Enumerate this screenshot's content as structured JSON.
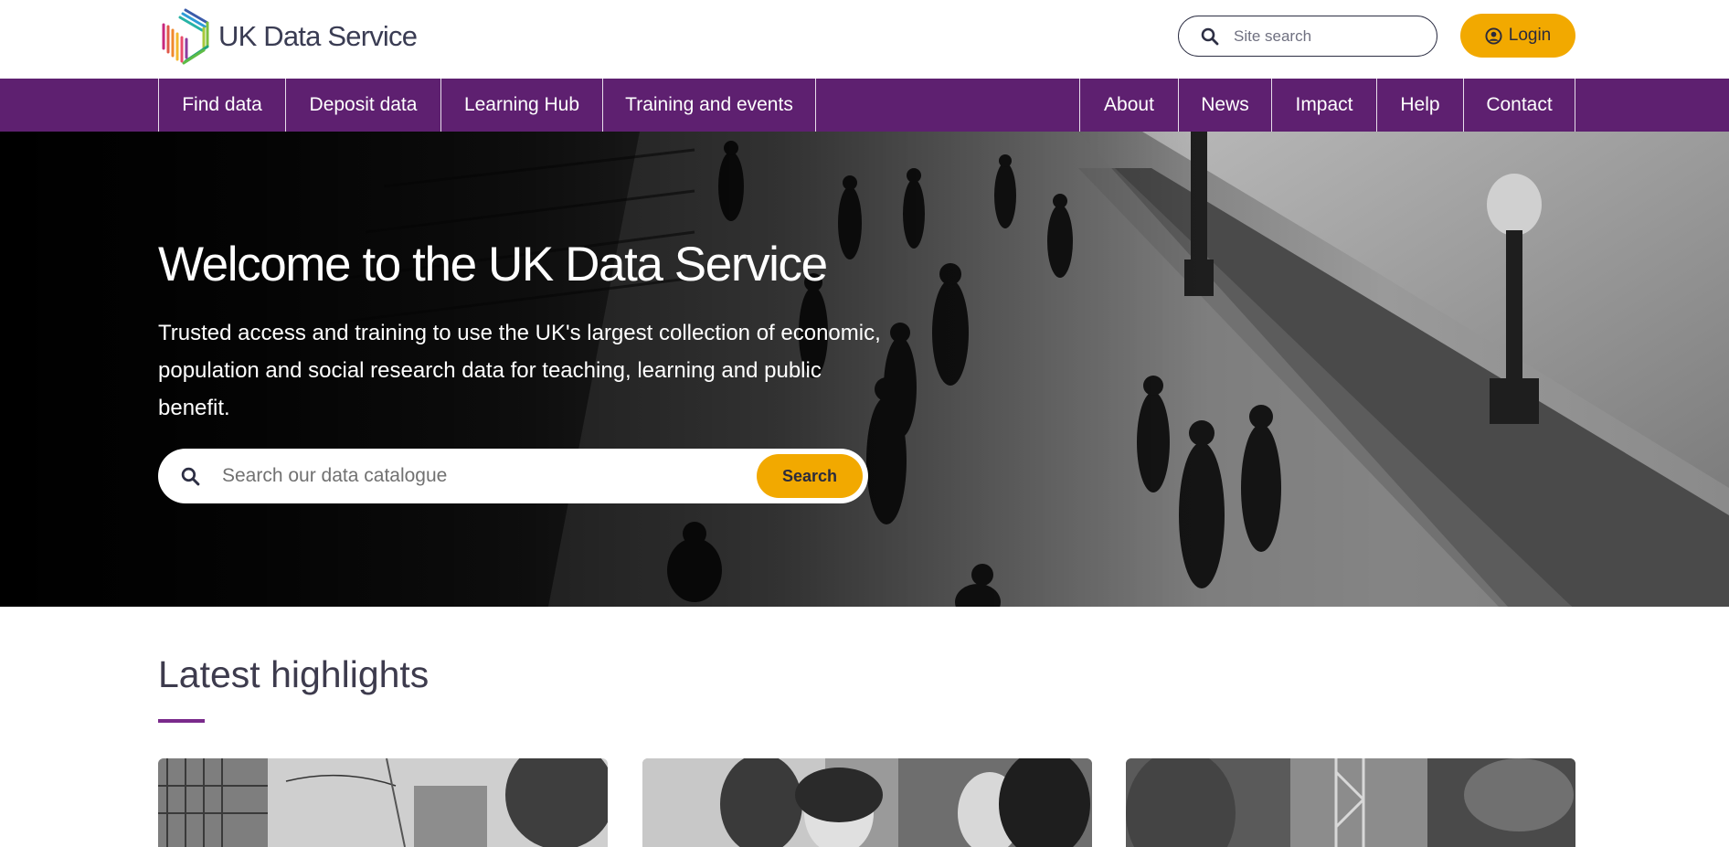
{
  "header": {
    "logo_text": "UK Data Service",
    "site_search_placeholder": "Site search",
    "login_label": "Login"
  },
  "nav": {
    "left_items": [
      {
        "label": "Find data"
      },
      {
        "label": "Deposit data"
      },
      {
        "label": "Learning Hub"
      },
      {
        "label": "Training and events"
      }
    ],
    "right_items": [
      {
        "label": "About"
      },
      {
        "label": "News"
      },
      {
        "label": "Impact"
      },
      {
        "label": "Help"
      },
      {
        "label": "Contact"
      }
    ]
  },
  "hero": {
    "title": "Welcome to the UK Data Service",
    "text": "Trusted access and training to use the UK's largest collection of economic, population and social research data for teaching, learning and public benefit.",
    "search_placeholder": "Search our data catalogue",
    "search_button": "Search"
  },
  "highlights": {
    "title": "Latest highlights"
  },
  "colors": {
    "nav_purple": "#5e2070",
    "accent_yellow": "#f2a900",
    "underline_purple": "#7a2a8b",
    "text_dark": "#2b2b3c"
  },
  "icons": {
    "site_search": "search-icon",
    "login": "user-circle-icon",
    "hero_search": "search-icon"
  }
}
